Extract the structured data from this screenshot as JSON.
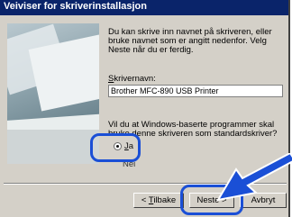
{
  "window": {
    "title": "Veiviser for skriverinstallasjon"
  },
  "content": {
    "intro": "Du kan skrive inn navnet på skriveren, eller bruke navnet som er angitt nedenfor. Velg Neste når du er ferdig.",
    "printer_name_label_underlined": "S",
    "printer_name_label_rest": "krivernavn:",
    "printer_name_value": "Brother MFC-890 USB Printer",
    "question": "Vil du at Windows-baserte programmer skal bruke denne skriveren som standardskriver?",
    "option_yes_underlined": "J",
    "option_yes_rest": "a",
    "option_no": "Nei",
    "option_selected": "yes"
  },
  "buttons": {
    "back_prefix": "< ",
    "back_underlined": "T",
    "back_rest": "ilbake",
    "next": "Neste >",
    "cancel": "Avbryt"
  },
  "colors": {
    "highlight": "#1a4fd6",
    "titlebar": "#0a246a"
  }
}
